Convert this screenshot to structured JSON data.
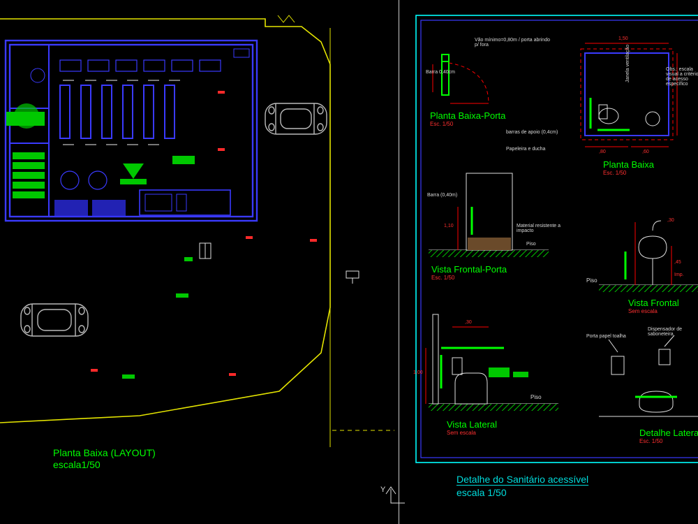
{
  "left": {
    "title": "Planta Baixa (LAYOUT)",
    "scale": "escala1/50"
  },
  "right": {
    "sheet_title": "Detalhe do Sanitário acessível",
    "sheet_scale": "escala 1/50",
    "views": {
      "pb_porta": {
        "title": "Planta Baixa-Porta",
        "scale": "Esc. 1/50",
        "note1": "Barra 0,40cm",
        "note2": "Vão mínimo=0,80m / porta abrindo p/ fora"
      },
      "pb": {
        "title": "Planta Baixa",
        "scale": "Esc. 1/50",
        "note_top": "Obs.: escala visual a critério de acesso específico",
        "side_label": "Janela ventilação",
        "dim1": "1,50",
        "dim2": ",80",
        "dim3": ",60",
        "legend1": "barras de apoio (0,4cm)",
        "legend2": "Papeleira e ducha"
      },
      "vf_porta": {
        "title": "Vista Frontal-Porta",
        "scale": "Esc. 1/50",
        "h": "1,10",
        "barra": "Barra (0,40m)",
        "note": "Material resistente a impacto",
        "piso": "Piso"
      },
      "vf": {
        "title": "Vista Frontal",
        "scale": "Sem escala",
        "piso": "Piso",
        "d1": ",30",
        "d2": ",45",
        "d3": "Imp."
      },
      "vl": {
        "title": "Vista Lateral",
        "scale": "Sem escala",
        "h": "1,00",
        "w": ",30",
        "piso": "Piso"
      },
      "dl": {
        "title": "Detalhe Lateral",
        "scale": "Esc. 1/50",
        "n1": "Porta papel toalha",
        "n2": "Dispensador de saboneteira"
      }
    }
  },
  "ucs": "Y"
}
